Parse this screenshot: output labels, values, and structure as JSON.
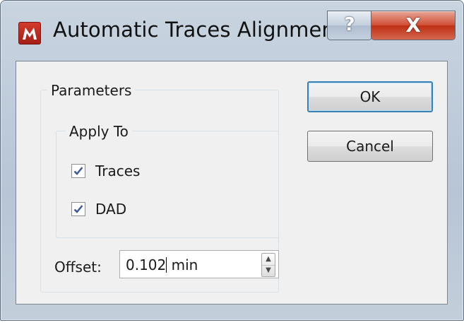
{
  "window": {
    "title": "Automatic Traces Alignment",
    "help_glyph": "?",
    "close_glyph": "X",
    "app_icon": "app-logo-icon"
  },
  "parameters": {
    "label": "Parameters",
    "apply_to": {
      "label": "Apply To",
      "options": [
        {
          "label": "Traces",
          "checked": true
        },
        {
          "label": "DAD",
          "checked": true
        }
      ]
    },
    "offset": {
      "label": "Offset:",
      "value": "0.102",
      "unit": "min"
    }
  },
  "buttons": {
    "ok": "OK",
    "cancel": "Cancel"
  },
  "colors": {
    "close_button": "#c8432a",
    "default_button_border": "#3c7fb1",
    "checkmark": "#3c5a9a"
  }
}
